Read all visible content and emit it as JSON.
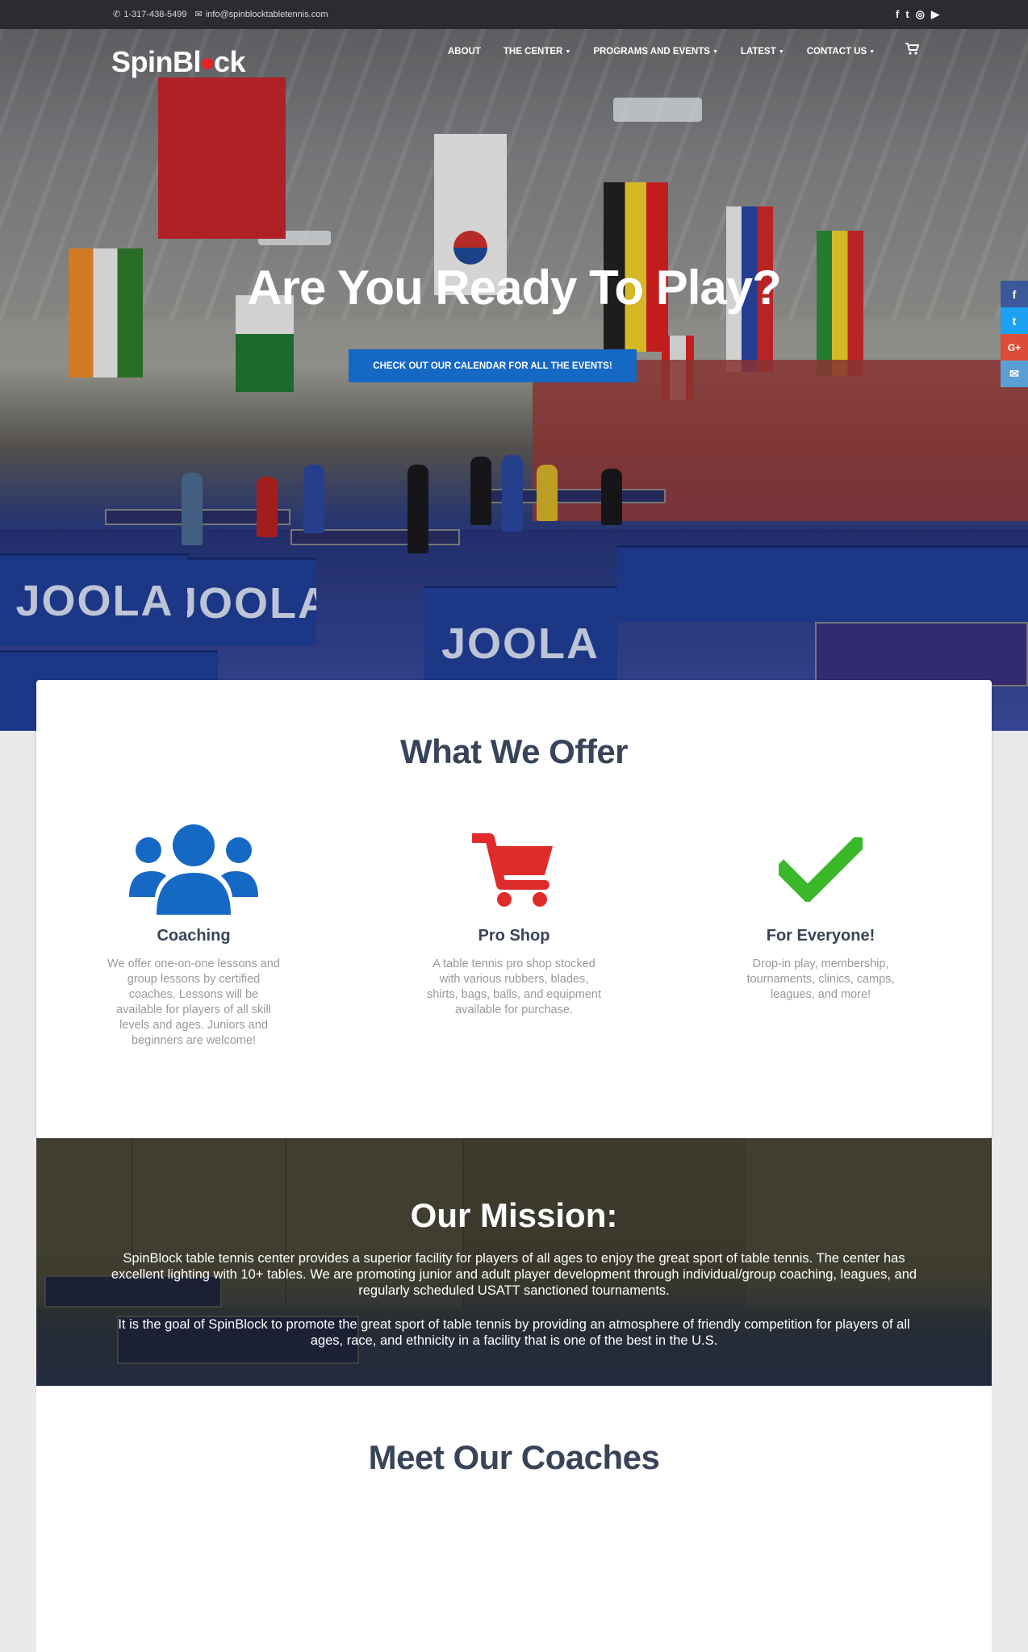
{
  "topbar": {
    "phone": "1-317-438-5499",
    "email": "info@spinblocktabletennis.com",
    "social": [
      "facebook-icon",
      "twitter-icon",
      "instagram-icon",
      "youtube-icon"
    ]
  },
  "brand": {
    "logo_pre": "SpinBl",
    "logo_post": "ck"
  },
  "nav": {
    "items": [
      {
        "label": "ABOUT",
        "dropdown": false
      },
      {
        "label": "THE CENTER",
        "dropdown": true
      },
      {
        "label": "PROGRAMS AND EVENTS",
        "dropdown": true
      },
      {
        "label": "LATEST",
        "dropdown": true
      },
      {
        "label": "CONTACT US",
        "dropdown": true
      }
    ],
    "cart_icon": "cart-icon"
  },
  "hero": {
    "title": "Are You Ready To Play?",
    "cta_label": "CHECK OUT OUR CALENDAR FOR ALL THE EVENTS!",
    "banner_text": "JOOLA"
  },
  "share": [
    {
      "icon": "facebook-icon",
      "glyph": "f",
      "color": "#3b5998"
    },
    {
      "icon": "twitter-icon",
      "glyph": "t",
      "color": "#1da1f2"
    },
    {
      "icon": "google-plus-icon",
      "glyph": "G+",
      "color": "#dd4b39"
    },
    {
      "icon": "email-icon",
      "glyph": "✉",
      "color": "#5aa0d6"
    }
  ],
  "offer": {
    "title": "What We Offer",
    "features": [
      {
        "icon": "users-icon",
        "title": "Coaching",
        "text": "We offer one-on-one lessons and group lessons by certified coaches. Lessons will be available for players of all skill levels and ages. Juniors and beginners are welcome!",
        "color": "#1668c5"
      },
      {
        "icon": "cart-icon",
        "title": "Pro Shop",
        "text": "A table tennis pro shop stocked with various rubbers, blades, shirts, bags, balls, and equipment available for purchase.",
        "color": "#e02b2b"
      },
      {
        "icon": "checkmark-icon",
        "title": "For Everyone!",
        "text": "Drop-in play, membership, tournaments, clinics, camps, leagues, and more!",
        "color": "#3ab82a"
      }
    ]
  },
  "mission": {
    "title": "Our Mission:",
    "p1": "SpinBlock table tennis center provides a superior facility for players of all ages to enjoy the great sport of table tennis. The center has excellent lighting with 10+ tables. We are promoting junior and adult player development through individual/group coaching, leagues, and regularly scheduled USATT sanctioned tournaments.",
    "p2": "It is the goal of SpinBlock to promote the great sport of table tennis by providing an atmosphere of friendly competition for players of all ages, race, and ethnicity in a facility that is one of the best in the U.S."
  },
  "coaches": {
    "title": "Meet Our Coaches"
  }
}
